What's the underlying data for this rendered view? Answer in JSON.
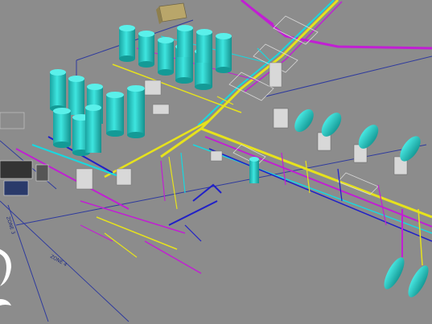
{
  "scene": {
    "zone_labels": [
      "ZONE 4",
      "ZONE 3"
    ]
  },
  "colors": {
    "background": "#8c8c8c",
    "tank": "#2ad4cf",
    "tank_shade": "#1aa3a0",
    "pipe_yellow": "#e6e21c",
    "pipe_magenta": "#c11fd3",
    "pipe_blue": "#2020c8",
    "pipe_cyan": "#18d8e0",
    "zone_line": "#2e3a9e",
    "structure": "#d8d8d8"
  }
}
